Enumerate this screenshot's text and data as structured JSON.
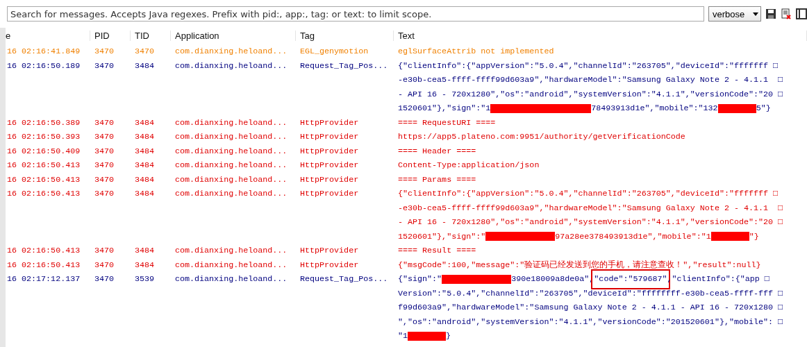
{
  "search": {
    "placeholder": "Search for messages. Accepts Java regexes. Prefix with pid:, app:, tag: or text: to limit scope."
  },
  "log_level_dropdown": {
    "value": "verbose"
  },
  "toolbar": [
    {
      "kind": "save"
    },
    {
      "kind": "clear"
    },
    {
      "kind": "panel"
    }
  ],
  "table": {
    "columns": [
      "e",
      "PID",
      "TID",
      "Application",
      "Tag",
      "Text"
    ],
    "rows": [
      {
        "color": "#f08000",
        "time": "16 02:16:41.849",
        "pid": "3470",
        "tid": "3470",
        "application": "com.dianxing.heloand...",
        "tag": "EGL_genymotion",
        "lines": [
          [
            {
              "kind": "text",
              "text": "eglSurfaceAttrib not implemented"
            }
          ]
        ]
      },
      {
        "color": "#00007f",
        "time": "16 02:16:50.189",
        "pid": "3470",
        "tid": "3484",
        "application": "com.dianxing.heloand...",
        "tag": "Request_Tag_Pos...",
        "lines": [
          [
            {
              "kind": "text",
              "text": "{\"clientInfo\":{\"appVersion\":\"5.0.4\",\"channelId\":\"263705\",\"deviceId\":\"fffffff □"
            }
          ],
          [
            {
              "kind": "text",
              "text": "-e30b-cea5-ffff-ffff99d603a9\",\"hardwareModel\":\"Samsung Galaxy Note 2 - 4.1.1  □"
            }
          ],
          [
            {
              "kind": "text",
              "text": "- API 16 - 720x1280\",\"os\":\"android\",\"systemVersion\":\"4.1.1\",\"versionCode\":\"20 □"
            }
          ],
          [
            {
              "kind": "text",
              "text": "1520601\"},\"sign\":\"1"
            },
            {
              "kind": "redaction_long"
            },
            {
              "kind": "text",
              "text": "78493913d1e\",\"mobile\":\"132"
            },
            {
              "kind": "redaction_short"
            },
            {
              "kind": "text",
              "text": "5\"}"
            }
          ]
        ]
      },
      {
        "color": "#e00000",
        "time": "16 02:16:50.389",
        "pid": "3470",
        "tid": "3484",
        "application": "com.dianxing.heloand...",
        "tag": "HttpProvider",
        "lines": [
          [
            {
              "kind": "text",
              "text": "==== RequestURI ===="
            }
          ]
        ]
      },
      {
        "color": "#e00000",
        "time": "16 02:16:50.393",
        "pid": "3470",
        "tid": "3484",
        "application": "com.dianxing.heloand...",
        "tag": "HttpProvider",
        "lines": [
          [
            {
              "kind": "text",
              "text": "https://app5.plateno.com:9951/authority/getVerificationCode"
            }
          ]
        ]
      },
      {
        "color": "#e00000",
        "time": "16 02:16:50.409",
        "pid": "3470",
        "tid": "3484",
        "application": "com.dianxing.heloand...",
        "tag": "HttpProvider",
        "lines": [
          [
            {
              "kind": "text",
              "text": "==== Header ===="
            }
          ]
        ]
      },
      {
        "color": "#e00000",
        "time": "16 02:16:50.413",
        "pid": "3470",
        "tid": "3484",
        "application": "com.dianxing.heloand...",
        "tag": "HttpProvider",
        "lines": [
          [
            {
              "kind": "text",
              "text": "Content-Type:application/json"
            }
          ]
        ]
      },
      {
        "color": "#e00000",
        "time": "16 02:16:50.413",
        "pid": "3470",
        "tid": "3484",
        "application": "com.dianxing.heloand...",
        "tag": "HttpProvider",
        "lines": [
          [
            {
              "kind": "text",
              "text": "==== Params ===="
            }
          ]
        ]
      },
      {
        "color": "#e00000",
        "time": "16 02:16:50.413",
        "pid": "3470",
        "tid": "3484",
        "application": "com.dianxing.heloand...",
        "tag": "HttpProvider",
        "lines": [
          [
            {
              "kind": "text",
              "text": "{\"clientInfo\":{\"appVersion\":\"5.0.4\",\"channelId\":\"263705\",\"deviceId\":\"fffffff □"
            }
          ],
          [
            {
              "kind": "text",
              "text": "-e30b-cea5-ffff-ffff99d603a9\",\"hardwareModel\":\"Samsung Galaxy Note 2 - 4.1.1  □"
            }
          ],
          [
            {
              "kind": "text",
              "text": "- API 16 - 720x1280\",\"os\":\"android\",\"systemVersion\":\"4.1.1\",\"versionCode\":\"20 □"
            }
          ],
          [
            {
              "kind": "text",
              "text": "1520601\"},\"sign\":\""
            },
            {
              "kind": "redaction_medium"
            },
            {
              "kind": "text",
              "text": "97a28ee378493913d1e\",\"mobile\":\"1"
            },
            {
              "kind": "redaction_short"
            },
            {
              "kind": "text",
              "text": "\"}"
            }
          ]
        ]
      },
      {
        "color": "#e00000",
        "time": "16 02:16:50.413",
        "pid": "3470",
        "tid": "3484",
        "application": "com.dianxing.heloand...",
        "tag": "HttpProvider",
        "lines": [
          [
            {
              "kind": "text",
              "text": "==== Result ===="
            }
          ]
        ]
      },
      {
        "color": "#e00000",
        "time": "16 02:16:50.413",
        "pid": "3470",
        "tid": "3484",
        "application": "com.dianxing.heloand...",
        "tag": "HttpProvider",
        "lines": [
          [
            {
              "kind": "text",
              "text": "{\"msgCode\":100,\"message\":\"验证码已经发送到您的手机，请注意查收！\",\"result\":null}"
            }
          ]
        ]
      },
      {
        "color": "#00007f",
        "time": "16 02:17:12.137",
        "pid": "3470",
        "tid": "3539",
        "application": "com.dianxing.heloand...",
        "tag": "Request_Tag_Pos...",
        "lines": [
          [
            {
              "kind": "text",
              "text": "{\"sign\":\""
            },
            {
              "kind": "redaction_medium"
            },
            {
              "kind": "text",
              "text": "390e18009a8de0a\","
            },
            {
              "kind": "boxed",
              "text": "\"code\":\"579687\""
            },
            {
              "kind": "text",
              "text": ",\"clientInfo\":{\"app □"
            }
          ],
          [
            {
              "kind": "text",
              "text": "Version\":\"5.0.4\",\"channelId\":\"263705\",\"deviceId\":\"ffffffff-e30b-cea5-ffff-fff □"
            }
          ],
          [
            {
              "kind": "text",
              "text": "f99d603a9\",\"hardwareModel\":\"Samsung Galaxy Note 2 - 4.1.1 - API 16 - 720x1280 □"
            }
          ],
          [
            {
              "kind": "text",
              "text": "\",\"os\":\"android\",\"systemVersion\":\"4.1.1\",\"versionCode\":\"201520601\"},\"mobile\": □"
            }
          ],
          [
            {
              "kind": "text",
              "text": "\"1"
            },
            {
              "kind": "redaction_short"
            },
            {
              "kind": "text",
              "text": "}"
            }
          ]
        ]
      }
    ]
  }
}
